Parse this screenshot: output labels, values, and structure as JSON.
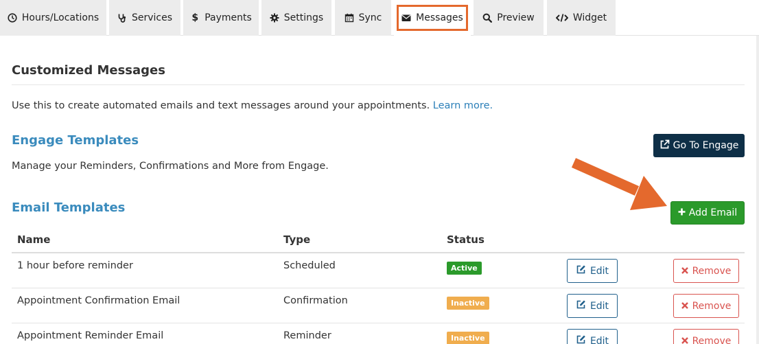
{
  "tabs": [
    {
      "label": "Hours/Locations",
      "icon": "clock-icon"
    },
    {
      "label": "Services",
      "icon": "stethoscope-icon"
    },
    {
      "label": "Payments",
      "icon": "dollar-icon"
    },
    {
      "label": "Settings",
      "icon": "gear-icon"
    },
    {
      "label": "Sync",
      "icon": "calendar-icon"
    },
    {
      "label": "Messages",
      "icon": "envelope-icon",
      "active": true
    },
    {
      "label": "Preview",
      "icon": "search-icon"
    },
    {
      "label": "Widget",
      "icon": "code-icon"
    }
  ],
  "page": {
    "title": "Customized Messages",
    "intro_text": "Use this to create automated emails and text messages around your appointments.",
    "learn_more": "Learn more."
  },
  "engage": {
    "heading": "Engage Templates",
    "description": "Manage your Reminders, Confirmations and More from Engage.",
    "button_label": "Go To Engage"
  },
  "email": {
    "heading": "Email Templates",
    "add_button_label": "Add Email",
    "columns": {
      "name": "Name",
      "type": "Type",
      "status": "Status"
    },
    "rows": [
      {
        "name": "1 hour before reminder",
        "type": "Scheduled",
        "status": "Active",
        "edit": "Edit",
        "remove": "Remove"
      },
      {
        "name": "Appointment Confirmation Email",
        "type": "Confirmation",
        "status": "Inactive",
        "edit": "Edit",
        "remove": "Remove"
      },
      {
        "name": "Appointment Reminder Email",
        "type": "Reminder",
        "status": "Inactive",
        "edit": "Edit",
        "remove": "Remove"
      }
    ]
  },
  "colors": {
    "accent_orange": "#e4692d",
    "heading_blue": "#3a8bbd",
    "engage_button": "#0e2f47",
    "add_button": "#2b9a2b",
    "active_badge": "#2b9a2b",
    "inactive_badge": "#f0ad4e",
    "remove_red": "#d9534f"
  }
}
